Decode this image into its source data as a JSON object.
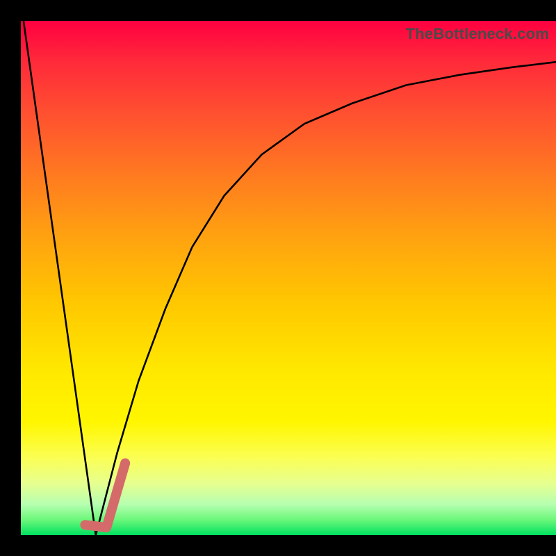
{
  "watermark": "TheBottleneck.com",
  "chart_data": {
    "type": "line",
    "title": "",
    "xlabel": "",
    "ylabel": "",
    "xlim": [
      0,
      100
    ],
    "ylim": [
      0,
      100
    ],
    "grid": false,
    "series": [
      {
        "name": "left-line",
        "stroke": "#000000",
        "x": [
          0.5,
          14
        ],
        "y": [
          100,
          0
        ]
      },
      {
        "name": "right-curve",
        "stroke": "#000000",
        "x": [
          14,
          18,
          22,
          27,
          32,
          38,
          45,
          53,
          62,
          72,
          82,
          92,
          100
        ],
        "y": [
          0,
          16,
          30,
          44,
          56,
          66,
          74,
          80,
          84,
          87.5,
          89.5,
          91,
          92
        ]
      },
      {
        "name": "highlight-segment",
        "stroke": "#d56a6a",
        "x": [
          12,
          16,
          19.5
        ],
        "y": [
          2,
          1.5,
          14
        ]
      }
    ],
    "gradient_bands_pct": {
      "green_start": 96,
      "yellow_mid": 65,
      "red_top": 0
    }
  },
  "colors": {
    "frame": "#000000",
    "curve": "#000000",
    "highlight": "#d56a6a",
    "watermark": "#4a4a4a"
  }
}
